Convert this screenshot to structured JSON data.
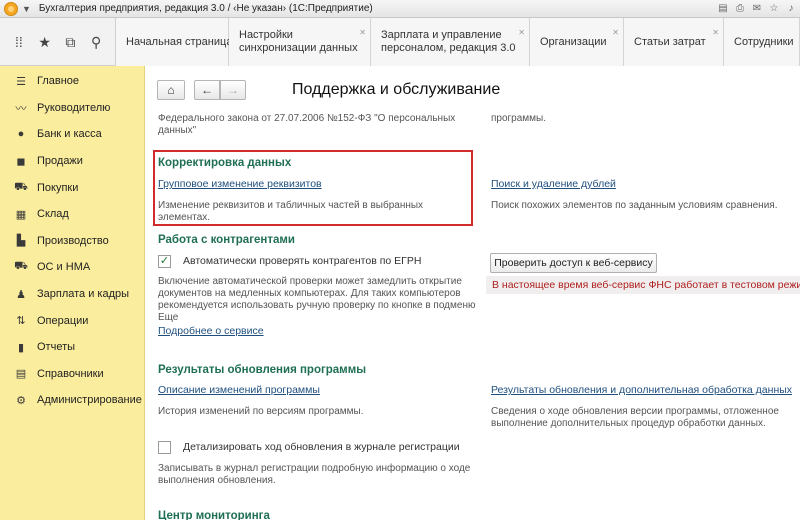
{
  "window": {
    "title": "Бухгалтерия предприятия, редакция 3.0 / ‹Не указан› (1С:Предприятие)"
  },
  "toolbar_icons": [
    "apps-grid-icon",
    "star-icon",
    "history-icon",
    "search-icon"
  ],
  "tabs": [
    {
      "label": "Начальная страница",
      "closable": false
    },
    {
      "label": "Настройки\nсинхронизации данных",
      "closable": true
    },
    {
      "label": "Зарплата и управление\nперсоналом, редакция 3.0",
      "closable": true
    },
    {
      "label": "Организации",
      "closable": true
    },
    {
      "label": "Статьи затрат",
      "closable": true
    },
    {
      "label": "Сотрудники",
      "closable": false
    }
  ],
  "sidebar": {
    "items": [
      {
        "label": "Главное",
        "icon": "menu-icon"
      },
      {
        "label": "Руководителю",
        "icon": "trend-icon"
      },
      {
        "label": "Банк и касса",
        "icon": "coin-icon"
      },
      {
        "label": "Продажи",
        "icon": "bag-icon"
      },
      {
        "label": "Покупки",
        "icon": "cart-icon"
      },
      {
        "label": "Склад",
        "icon": "warehouse-icon"
      },
      {
        "label": "Производство",
        "icon": "factory-icon"
      },
      {
        "label": "ОС и НМА",
        "icon": "truck-icon"
      },
      {
        "label": "Зарплата и кадры",
        "icon": "person-icon"
      },
      {
        "label": "Операции",
        "icon": "operations-icon"
      },
      {
        "label": "Отчеты",
        "icon": "report-icon"
      },
      {
        "label": "Справочники",
        "icon": "catalog-icon"
      },
      {
        "label": "Администрирование",
        "icon": "gear-icon"
      }
    ]
  },
  "main": {
    "title": "Поддержка и обслуживание",
    "top_clip_left": "Федерального закона от 27.07.2006 №152-ФЗ \"О персональных данных\"",
    "top_clip_right": "программы.",
    "data_correction": {
      "header": "Корректировка данных",
      "group_change_link": "Групповое изменение реквизитов",
      "group_change_desc": "Изменение реквизитов и табличных частей в выбранных элементах.",
      "duplicates_link": "Поиск и удаление дублей",
      "duplicates_desc": "Поиск похожих элементов по заданным условиям сравнения."
    },
    "counterparties": {
      "header": "Работа с контрагентами",
      "auto_check_label": "Автоматически проверять контрагентов по ЕГРН",
      "auto_check_checked": true,
      "auto_check_desc": "Включение автоматической проверки может замедлить открытие документов на медленных компьютерах. Для таких компьютеров рекомендуется использовать ручную проверку по кнопке в подменю Еще",
      "service_link": "Подробнее о сервисе",
      "check_button": "Проверить доступ к веб-сервису",
      "alert_text": "В настоящее время веб-сервис ФНС работает в тестовом режиме."
    },
    "update_results": {
      "header": "Результаты обновления программы",
      "changes_link": "Описание изменений программы",
      "changes_desc": "История изменений по версиям программы.",
      "results_link": "Результаты обновления и дополнительная обработка данных",
      "results_desc": "Сведения о ходе обновления версии программы, отложенное выполнение дополнительных процедур обработки данных.",
      "detail_label": "Детализировать ход обновления в журнале регистрации",
      "detail_checked": false,
      "detail_desc": "Записывать в журнал регистрации подробную информацию о ходе выполнения обновления."
    },
    "monitoring": {
      "header": "Центр мониторинга"
    }
  }
}
